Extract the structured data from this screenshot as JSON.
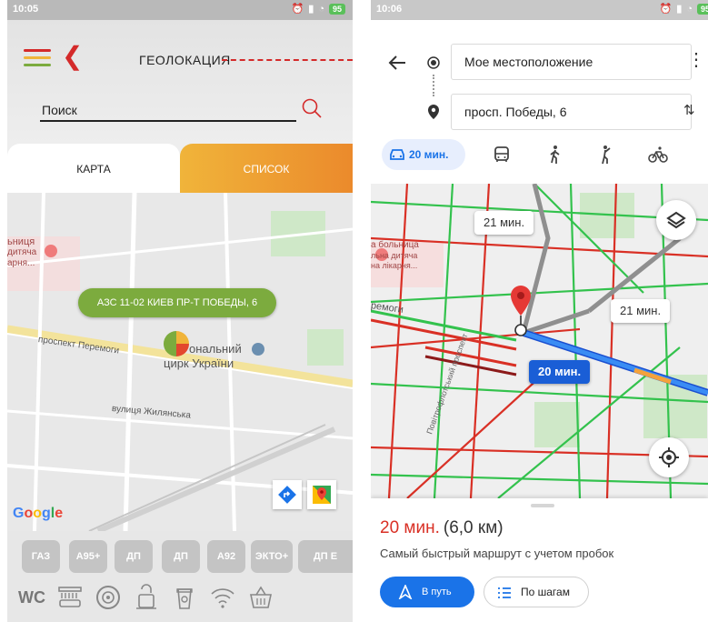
{
  "left": {
    "status": {
      "time": "10:05",
      "battery": "95"
    },
    "header": {
      "title": "ГЕОЛОКАЦИЯ"
    },
    "search": {
      "placeholder": "Поиск"
    },
    "tabs": [
      {
        "label": "КАРТА"
      },
      {
        "label": "СПИСОК"
      }
    ],
    "map": {
      "labels": {
        "hospital": "ьниця",
        "hospital2": "дитяча",
        "hospital3": "арня...",
        "avenue": "проспект Перемоги",
        "street": "вулиця Жилянська",
        "circus_1": "ональний",
        "circus_2": "цирк України"
      },
      "station_pill": "АЗС 11-02 КИЕВ ПР-Т ПОБЕДЫ, 6",
      "google": "Google"
    },
    "fuels": [
      "ГАЗ",
      "А95+",
      "ДП",
      "ДП",
      "А92",
      "ЭКТО+",
      "ДП Е"
    ],
    "amenities": [
      {
        "icon": "wc-icon",
        "label": "WC"
      },
      {
        "icon": "car-wash-icon"
      },
      {
        "icon": "tire-service-icon"
      },
      {
        "icon": "vacuum-icon"
      },
      {
        "icon": "coffee-icon"
      },
      {
        "icon": "wifi-icon"
      },
      {
        "icon": "shop-basket-icon"
      }
    ],
    "colors": {
      "accent_red": "#d42a2a",
      "tab_orange": "#eb8a2c",
      "pill_green": "#7cab3e"
    }
  },
  "right": {
    "status": {
      "time": "10:06",
      "battery": "95"
    },
    "route": {
      "from": "Мое местоположение",
      "to": "просп. Победы, 6"
    },
    "modes": {
      "active_time": "20 мин."
    },
    "map": {
      "labels": {
        "hospital1": "а больница",
        "hospital2": "льна дитяча",
        "hospital3": "на лікарня...",
        "peremogy": "ремоги",
        "povitroflotskyi": "Повітрофлотський проспект"
      },
      "badge_alt1": "21 мин.",
      "badge_alt2": "21 мин.",
      "badge_main": "20 мин."
    },
    "sheet": {
      "duration": "20 мин.",
      "distance": "(6,0 км)",
      "description": "Самый быстрый маршрут с учетом пробок",
      "go_label": "В путь",
      "steps_label": "По шагам"
    },
    "colors": {
      "route_blue": "#1a73e8",
      "traffic_red": "#d93025",
      "traffic_green": "#33c24d"
    }
  }
}
